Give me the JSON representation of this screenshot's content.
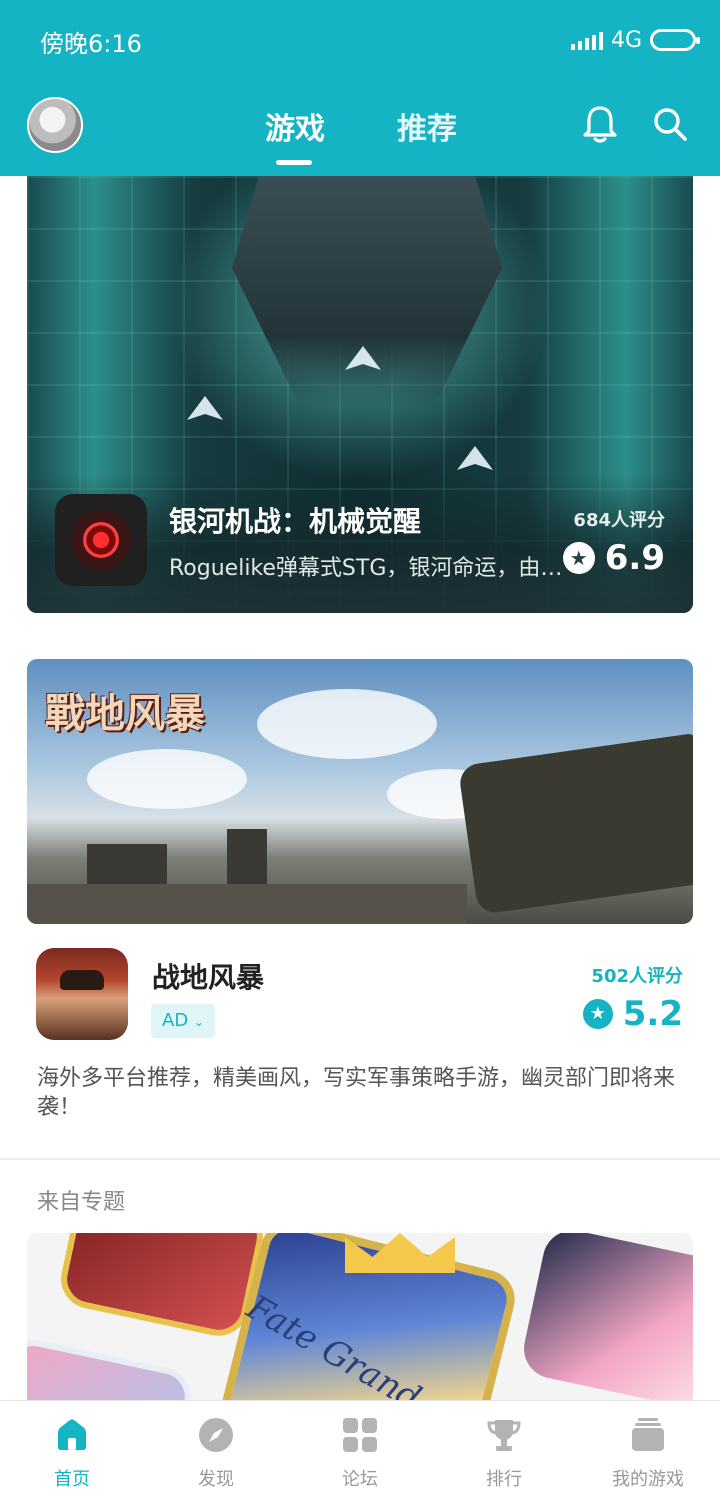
{
  "status_bar": {
    "time": "傍晚6:16",
    "network": "4G"
  },
  "top_nav": {
    "tabs": [
      {
        "label": "游戏",
        "active": true
      },
      {
        "label": "推荐",
        "active": false
      }
    ]
  },
  "featured_game": {
    "title": "银河机战：机械觉醒",
    "description": "Roguelike弹幕式STG，银河命运，由…",
    "rating_count": "684人评分",
    "rating": "6.9"
  },
  "ad_game": {
    "title": "战地风暴",
    "badge": "AD",
    "rating_count": "502人评分",
    "rating": "5.2",
    "description": "海外多平台推荐，精美画风，写实军事策略手游，幽灵部门即将来袭！",
    "banner_logo": "戰地风暴"
  },
  "topic_section": {
    "label": "来自专题",
    "banner_text": "Fate Grand"
  },
  "bottom_nav": [
    {
      "label": "首页",
      "icon": "home-icon",
      "active": true
    },
    {
      "label": "发现",
      "icon": "compass-icon",
      "active": false
    },
    {
      "label": "论坛",
      "icon": "grid-icon",
      "active": false
    },
    {
      "label": "排行",
      "icon": "trophy-icon",
      "active": false
    },
    {
      "label": "我的游戏",
      "icon": "stack-icon",
      "active": false
    }
  ],
  "colors": {
    "accent": "#14b4c4",
    "inactive": "#999999"
  }
}
